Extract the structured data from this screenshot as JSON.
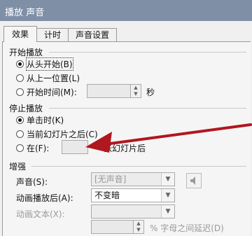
{
  "title": "播放 声音",
  "tabs": [
    {
      "label": "效果",
      "active": true
    },
    {
      "label": "计时",
      "active": false
    },
    {
      "label": "声音设置",
      "active": false
    }
  ],
  "start": {
    "heading": "开始播放",
    "options": [
      "从头开始(B)",
      "从上一位置(L)",
      "开始时间(M):"
    ],
    "selected": 0,
    "time_value": "",
    "time_unit": "秒"
  },
  "stop": {
    "heading": "停止播放",
    "options": [
      "单击时(K)",
      "当前幻灯片之后(C)",
      "在(F):"
    ],
    "selected": 0,
    "after_slides_value": "",
    "after_slides_label": "张幻灯片后"
  },
  "enhance": {
    "heading": "增强",
    "sound_label": "声音(S):",
    "sound_value": "[无声音]",
    "after_anim_label": "动画播放后(A):",
    "after_anim_value": "不变暗",
    "anim_text_label": "动画文本(X):",
    "anim_text_value": "",
    "delay_value": "",
    "delay_label": "% 字母之间延迟(D)"
  },
  "annotation": {
    "arrow_color": "#b0171f"
  },
  "colors": {
    "titlebar": "#7f8fa6",
    "panel": "#f5f5f5"
  }
}
